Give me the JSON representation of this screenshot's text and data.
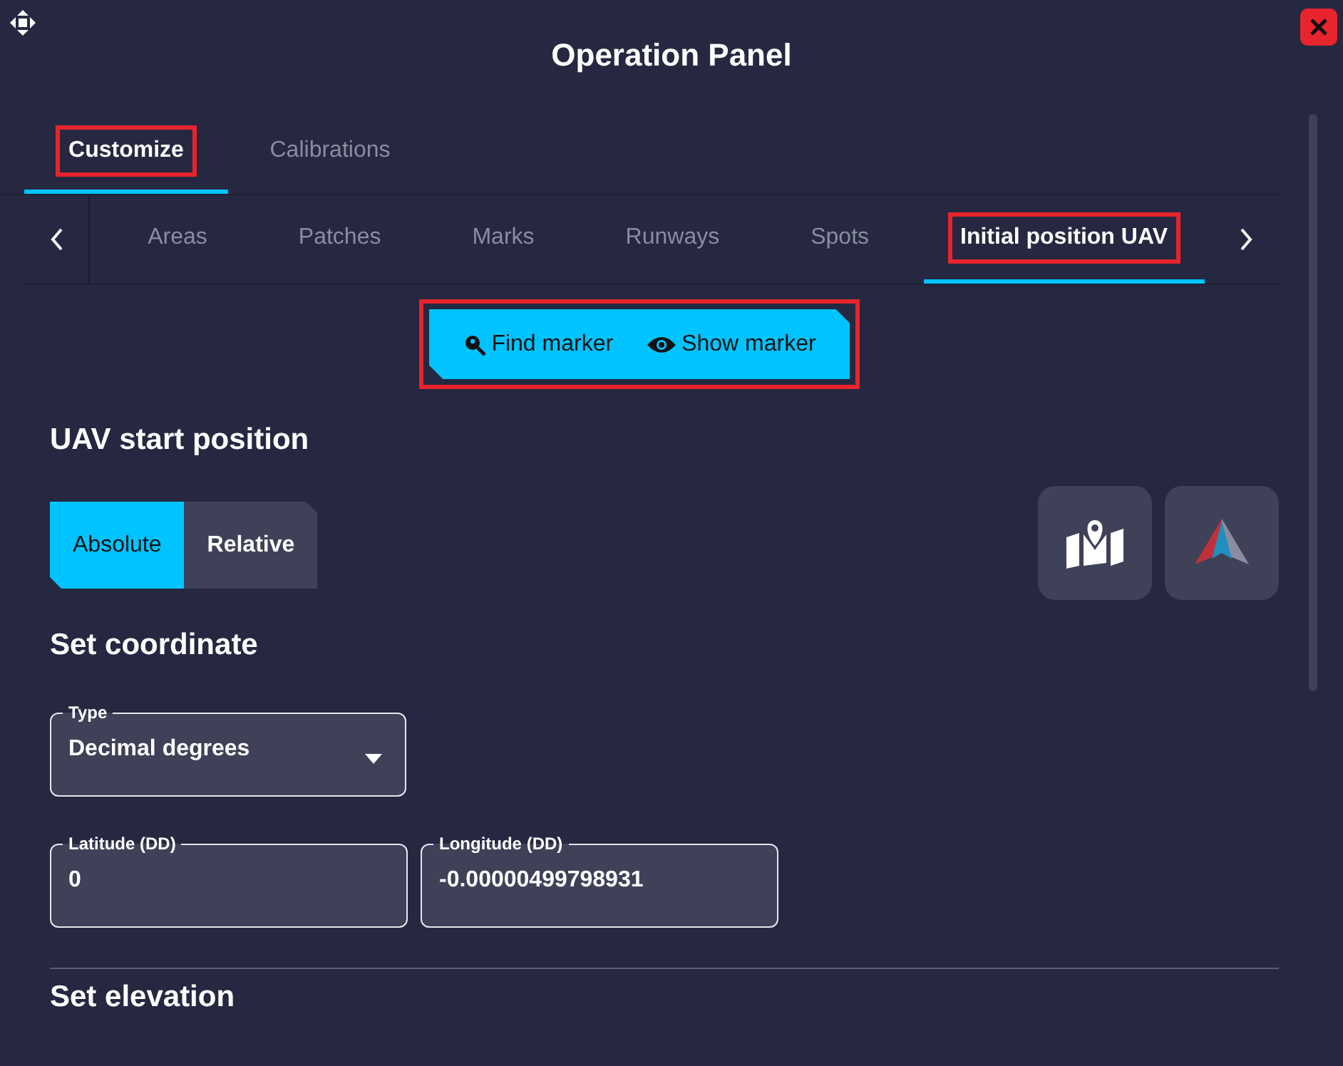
{
  "window": {
    "title": "Operation Panel"
  },
  "tabs": [
    {
      "label": "Customize",
      "selected": true,
      "highlighted": true
    },
    {
      "label": "Calibrations",
      "selected": false,
      "highlighted": false
    }
  ],
  "subtabs": [
    {
      "label": "Areas",
      "selected": false,
      "highlighted": false
    },
    {
      "label": "Patches",
      "selected": false,
      "highlighted": false
    },
    {
      "label": "Marks",
      "selected": false,
      "highlighted": false
    },
    {
      "label": "Runways",
      "selected": false,
      "highlighted": false
    },
    {
      "label": "Spots",
      "selected": false,
      "highlighted": false
    },
    {
      "label": "Initial position UAV",
      "selected": true,
      "highlighted": true
    }
  ],
  "marker_actions": {
    "highlighted": true,
    "buttons": [
      {
        "kind": "find",
        "label": "Find marker"
      },
      {
        "kind": "show",
        "label": "Show marker"
      }
    ]
  },
  "start_position": {
    "heading": "UAV start position",
    "modes": [
      {
        "label": "Absolute",
        "selected": true
      },
      {
        "label": "Relative",
        "selected": false
      }
    ],
    "tools": [
      {
        "kind": "map"
      },
      {
        "kind": "arrow"
      }
    ]
  },
  "coordinate": {
    "heading": "Set coordinate",
    "type": {
      "label": "Type",
      "value": "Decimal degrees"
    },
    "fields": [
      {
        "label": "Latitude (DD)",
        "value": "0"
      },
      {
        "label": "Longitude (DD)",
        "value": "-0.00000499798931"
      }
    ]
  },
  "elevation": {
    "heading": "Set elevation"
  }
}
